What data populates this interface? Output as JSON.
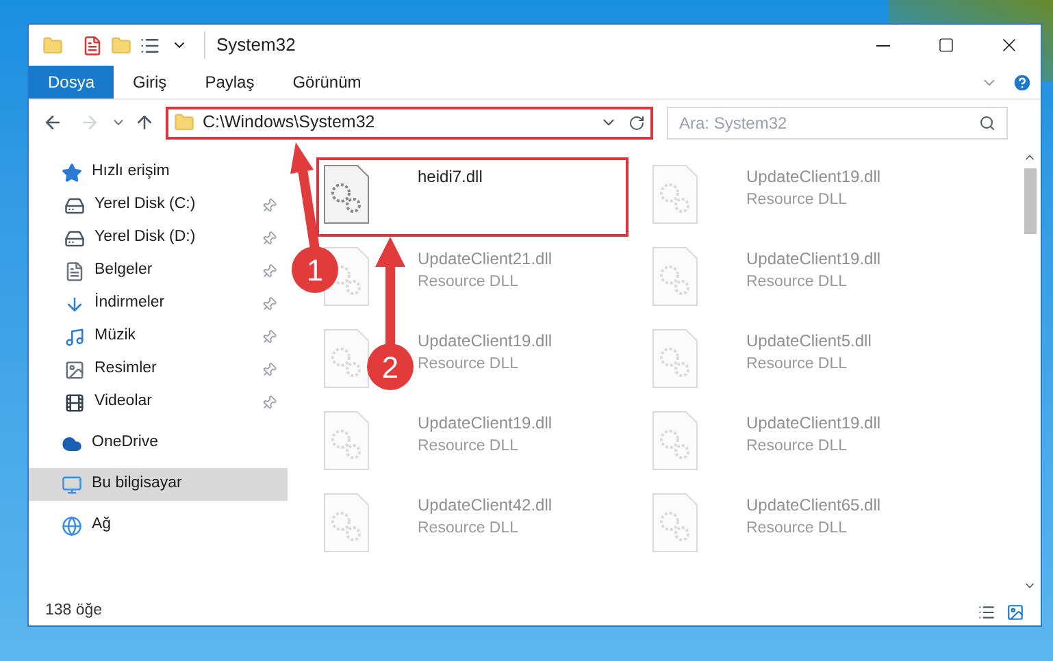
{
  "window": {
    "title": "System32"
  },
  "ribbon_tabs": [
    {
      "label": "Dosya",
      "selected": true
    },
    {
      "label": "Giriş",
      "selected": false
    },
    {
      "label": "Paylaş",
      "selected": false
    },
    {
      "label": "Görünüm",
      "selected": false
    }
  ],
  "address_bar": {
    "path": "C:\\Windows\\System32",
    "highlighted": true
  },
  "search": {
    "placeholder": "Ara: System32"
  },
  "sidebar": {
    "items": [
      {
        "label": "Hızlı erişim",
        "kind": "star",
        "selected": false,
        "children": [
          {
            "label": "Yerel Disk (C:)",
            "kind": "drive",
            "pinned": true,
            "selected": false
          },
          {
            "label": "Yerel Disk (D:)",
            "kind": "drive",
            "pinned": true,
            "selected": false
          },
          {
            "label": "Belgeler",
            "kind": "document",
            "pinned": true,
            "selected": false
          },
          {
            "label": "İndirmeler",
            "kind": "download",
            "pinned": true,
            "selected": false
          },
          {
            "label": "Müzik",
            "kind": "music",
            "pinned": true,
            "selected": false
          },
          {
            "label": "Resimler",
            "kind": "picture",
            "pinned": true,
            "selected": false
          },
          {
            "label": "Videolar",
            "kind": "video",
            "pinned": true,
            "selected": false
          }
        ]
      },
      {
        "label": "OneDrive",
        "kind": "cloud",
        "selected": false
      },
      {
        "label": "Bu bilgisayar",
        "kind": "computer",
        "selected": true
      },
      {
        "label": "Ağ",
        "kind": "network",
        "selected": false
      }
    ]
  },
  "files": [
    {
      "name": "heidi7.dll",
      "faded": false,
      "highlighted": true
    },
    {
      "name": "UpdateClient19.dll",
      "type": "Resource DLL",
      "faded": true,
      "highlighted": false
    },
    {
      "name": "UpdateClient21.dll",
      "type": "Resource DLL",
      "faded": true,
      "highlighted": false
    },
    {
      "name": "UpdateClient19.dll",
      "type": "Resource DLL",
      "faded": true,
      "highlighted": false
    },
    {
      "name": "UpdateClient19.dll",
      "type": "Resource DLL",
      "faded": true,
      "highlighted": false
    },
    {
      "name": "UpdateClient5.dll",
      "type": "Resource DLL",
      "faded": true,
      "highlighted": false
    },
    {
      "name": "UpdateClient19.dll",
      "type": "Resource DLL",
      "faded": true,
      "highlighted": false
    },
    {
      "name": "UpdateClient19.dll",
      "type": "Resource DLL",
      "faded": true,
      "highlighted": false
    },
    {
      "name": "UpdateClient42.dll",
      "type": "Resource DLL",
      "faded": true,
      "highlighted": false
    },
    {
      "name": "UpdateClient65.dll",
      "type": "Resource DLL",
      "faded": true,
      "highlighted": false
    }
  ],
  "status_bar": {
    "count": "138 öğe"
  },
  "annotations": [
    {
      "label": "1"
    },
    {
      "label": "2"
    }
  ]
}
